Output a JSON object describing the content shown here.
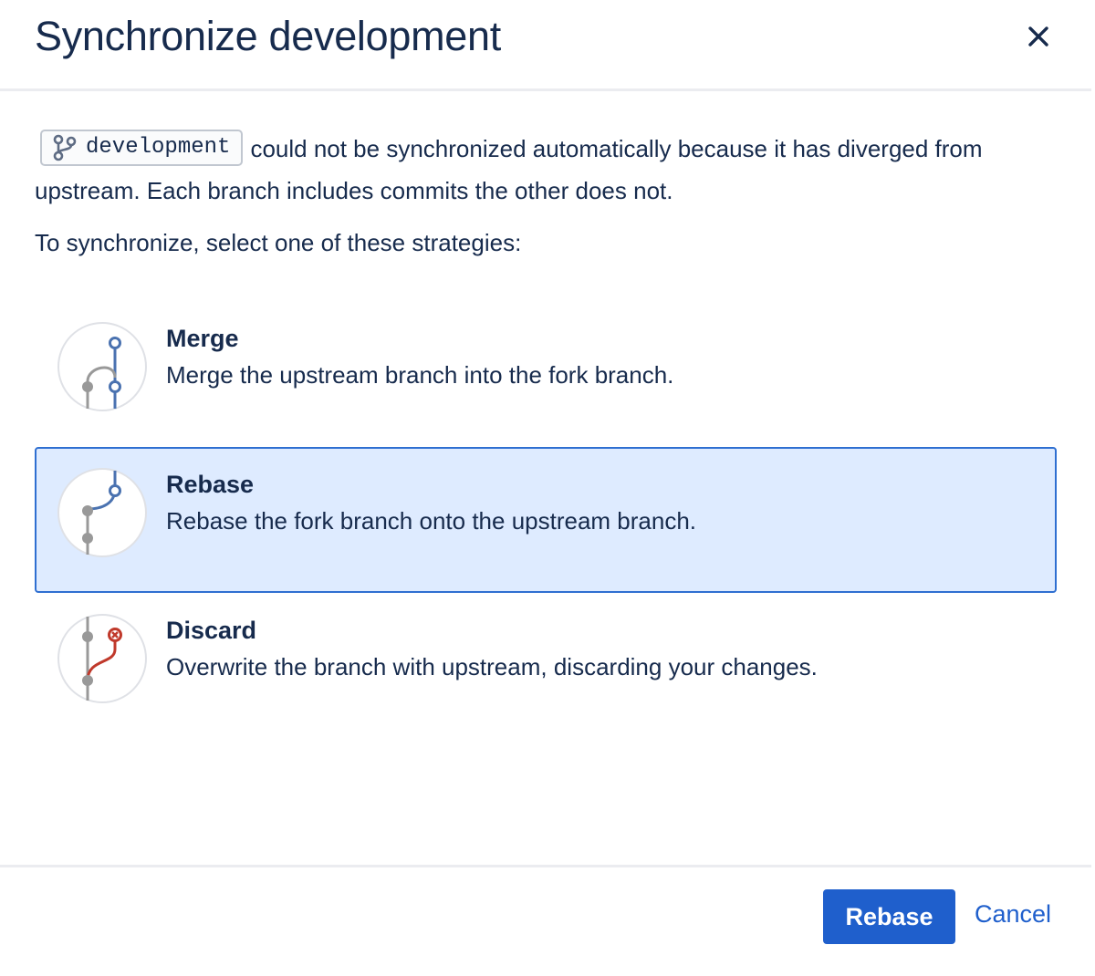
{
  "dialog": {
    "title": "Synchronize development",
    "close_label": "×"
  },
  "intro": {
    "branch_name": "development",
    "message": "could not be synchronized automatically because it has diverged from upstream. Each branch includes commits the other does not.",
    "prompt": "To synchronize, select one of these strategies:"
  },
  "options": [
    {
      "title": "Merge",
      "description": "Merge the upstream branch into the fork branch.",
      "icon": "merge-icon",
      "selected": false
    },
    {
      "title": "Rebase",
      "description": "Rebase the fork branch onto the upstream branch.",
      "icon": "rebase-icon",
      "selected": true
    },
    {
      "title": "Discard",
      "description": "Overwrite the branch with upstream, discarding your changes.",
      "icon": "discard-icon",
      "selected": false
    }
  ],
  "footer": {
    "primary_label": "Rebase",
    "cancel_label": "Cancel"
  },
  "colors": {
    "accent": "#1f5fcc",
    "selected_bg": "#deebff",
    "branch_blue": "#4a72b0",
    "branch_gray": "#999999",
    "discard_red": "#c0392b"
  }
}
